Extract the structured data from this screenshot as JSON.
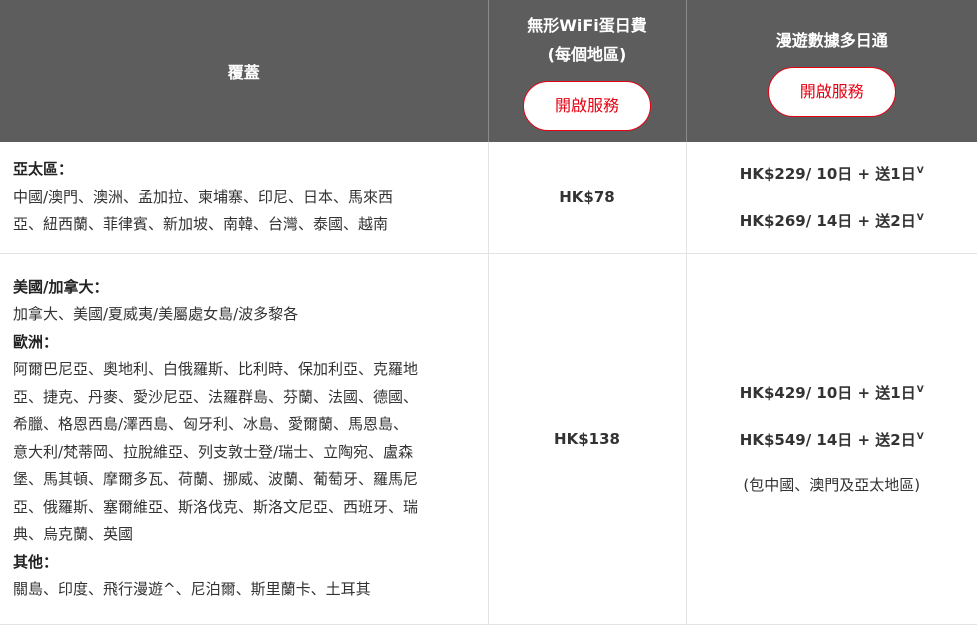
{
  "header": {
    "coverage": "覆蓋",
    "wifi_title_line1": "無形WiFi蛋日費",
    "wifi_title_line2": "(每個地區)",
    "wifi_button": "開啟服務",
    "roaming_title": "漫遊數據多日通",
    "roaming_button": "開啟服務"
  },
  "rows": [
    {
      "groups": [
        {
          "title": "亞太區：",
          "lines": [
            "中國/澳門、澳洲、孟加拉、柬埔寨、印尼、日本、馬來西",
            "亞、紐西蘭、菲律賓、新加坡、南韓、台灣、泰國、越南"
          ]
        }
      ],
      "wifi_price": "HK$78",
      "passes": [
        {
          "text": "HK$229/ 10日 + 送1日",
          "mark": "V"
        },
        {
          "text": "HK$269/ 14日 + 送2日",
          "mark": "V"
        }
      ]
    },
    {
      "groups": [
        {
          "title": "美國/加拿大：",
          "lines": [
            "加拿大、美國/夏威夷/美屬處女島/波多黎各"
          ]
        },
        {
          "title": "歐洲：",
          "lines": [
            "阿爾巴尼亞、奧地利、白俄羅斯、比利時、保加利亞、克羅地",
            "亞、捷克、丹麥、愛沙尼亞、法羅群島、芬蘭、法國、德國、",
            "希臘、格恩西島/澤西島、匈牙利、冰島、愛爾蘭、馬恩島、",
            "意大利/梵蒂岡、拉脫維亞、列支敦士登/瑞士、立陶宛、盧森",
            "堡、馬其頓、摩爾多瓦、荷蘭、挪威、波蘭、葡萄牙、羅馬尼",
            "亞、俄羅斯、塞爾維亞、斯洛伐克、斯洛文尼亞、西班牙、瑞",
            "典、烏克蘭、英國"
          ]
        },
        {
          "title": "其他：",
          "lines": [
            "關島、印度、飛行漫遊^、尼泊爾、斯里蘭卡、土耳其"
          ]
        }
      ],
      "wifi_price": "HK$138",
      "passes": [
        {
          "text": "HK$429/ 10日 + 送1日",
          "mark": "V"
        },
        {
          "text": "HK$549/ 14日 + 送2日",
          "mark": "V"
        }
      ],
      "note": "(包中國、澳門及亞太地區)"
    }
  ]
}
